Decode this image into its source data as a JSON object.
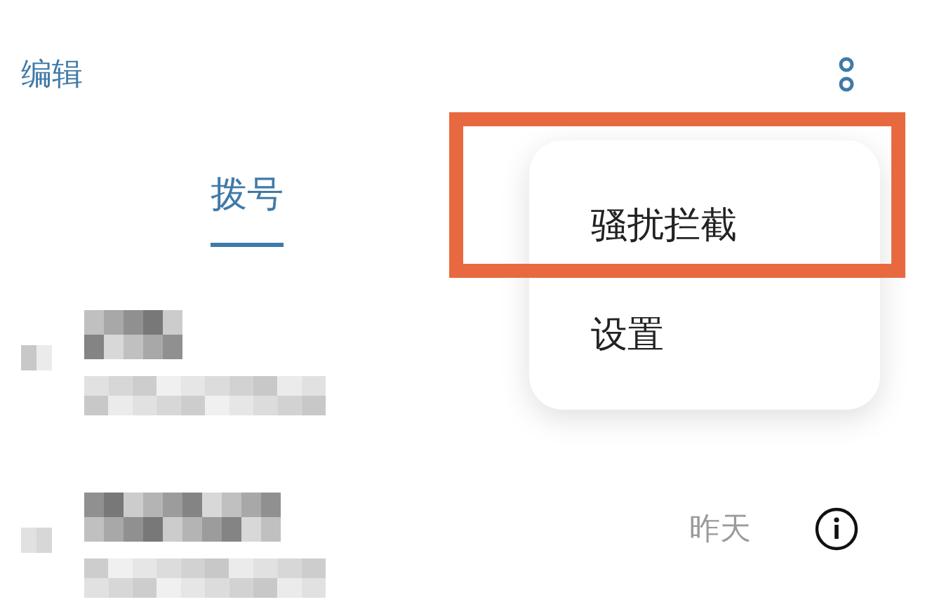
{
  "header": {
    "edit_label": "编辑"
  },
  "tabs": [
    {
      "label": "拨号",
      "selected": true
    }
  ],
  "calls": [
    {
      "redacted": true
    },
    {
      "redacted": true,
      "time": "昨天"
    }
  ],
  "menu": {
    "items": [
      {
        "label": "骚扰拦截",
        "highlighted": true
      },
      {
        "label": "设置",
        "highlighted": false
      }
    ]
  }
}
